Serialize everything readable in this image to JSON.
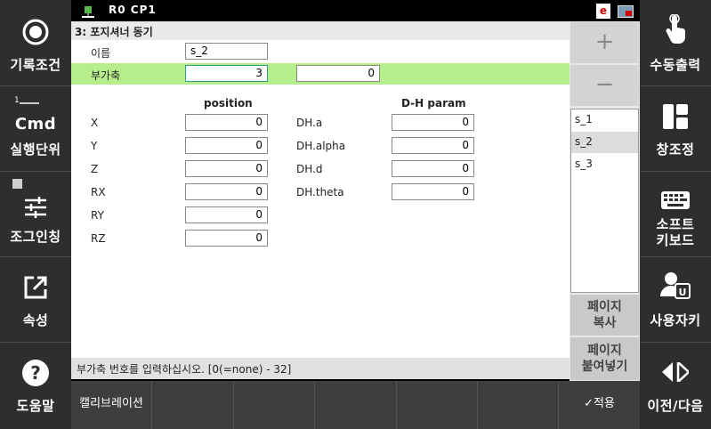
{
  "left_sidebar": [
    {
      "label": "기록조건",
      "icon": "record-icon"
    },
    {
      "label": "실행단위",
      "icon": "cmd-icon",
      "icon_text": "Cmd"
    },
    {
      "label": "조그인칭",
      "icon": "sliders-icon"
    },
    {
      "label": "속성",
      "icon": "open-external-icon"
    },
    {
      "label": "도움말",
      "icon": "help-icon"
    }
  ],
  "right_sidebar": [
    {
      "label": "수동출력",
      "icon": "touch-hand-icon"
    },
    {
      "label": "창조정",
      "icon": "window-layout-icon"
    },
    {
      "label": "소프트\n키보드",
      "icon": "keyboard-icon"
    },
    {
      "label": "사용자키",
      "icon": "user-key-icon"
    },
    {
      "label": "이전/다음",
      "icon": "prev-next-icon"
    }
  ],
  "status_top": {
    "mode": "R0   CP1",
    "badge": "e"
  },
  "page": {
    "title": "3: 포지셔너 동기",
    "name_label": "이름",
    "name_value": "s_2",
    "aux_label": "부가축",
    "aux_value1": "3",
    "aux_value2": "0",
    "position_header": "position",
    "dh_header": "D-H param",
    "position": [
      {
        "label": "X",
        "value": "0"
      },
      {
        "label": "Y",
        "value": "0"
      },
      {
        "label": "Z",
        "value": "0"
      },
      {
        "label": "RX",
        "value": "0"
      },
      {
        "label": "RY",
        "value": "0"
      },
      {
        "label": "RZ",
        "value": "0"
      }
    ],
    "dh": [
      {
        "label": "DH.a",
        "value": "0"
      },
      {
        "label": "DH.alpha",
        "value": "0"
      },
      {
        "label": "DH.d",
        "value": "0"
      },
      {
        "label": "DH.theta",
        "value": "0"
      }
    ]
  },
  "hint": "부가축 번호를 입력하십시오. [0(=none) - 32]",
  "list": {
    "plus": "+",
    "minus": "−",
    "items": [
      "s_1",
      "s_2",
      "s_3"
    ],
    "selected": "s_2",
    "copy_page": "페이지\n복사",
    "paste_page": "페이지\n붙여넣기"
  },
  "bottom_bar": {
    "calibration": "캘리브레이션",
    "apply": "✓적용"
  },
  "colors": {
    "highlight": "#b7ee8c",
    "selected_border": "#2c9c8f"
  }
}
